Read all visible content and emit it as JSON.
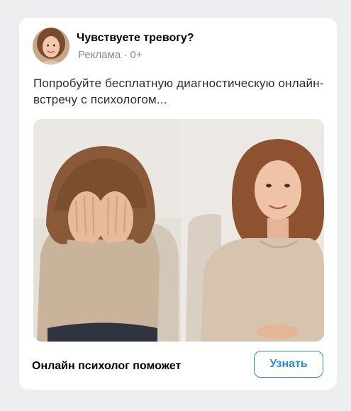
{
  "ad": {
    "title": "Чувствуете тревогу?",
    "meta": "Реклама · 0+",
    "text": "Попробуйте бесплатную диагностическую онлайн-встречу с психологом...",
    "caption": "Онлайн психолог поможет",
    "cta_label": "Узнать"
  },
  "colors": {
    "accent": "#2688eb",
    "meta_text": "#818c99",
    "card_bg": "#ffffff",
    "page_bg": "#edeef0"
  },
  "images": {
    "avatar": "woman-portrait",
    "left_panel": "distressed-woman-covering-face",
    "right_panel": "calm-smiling-woman"
  }
}
